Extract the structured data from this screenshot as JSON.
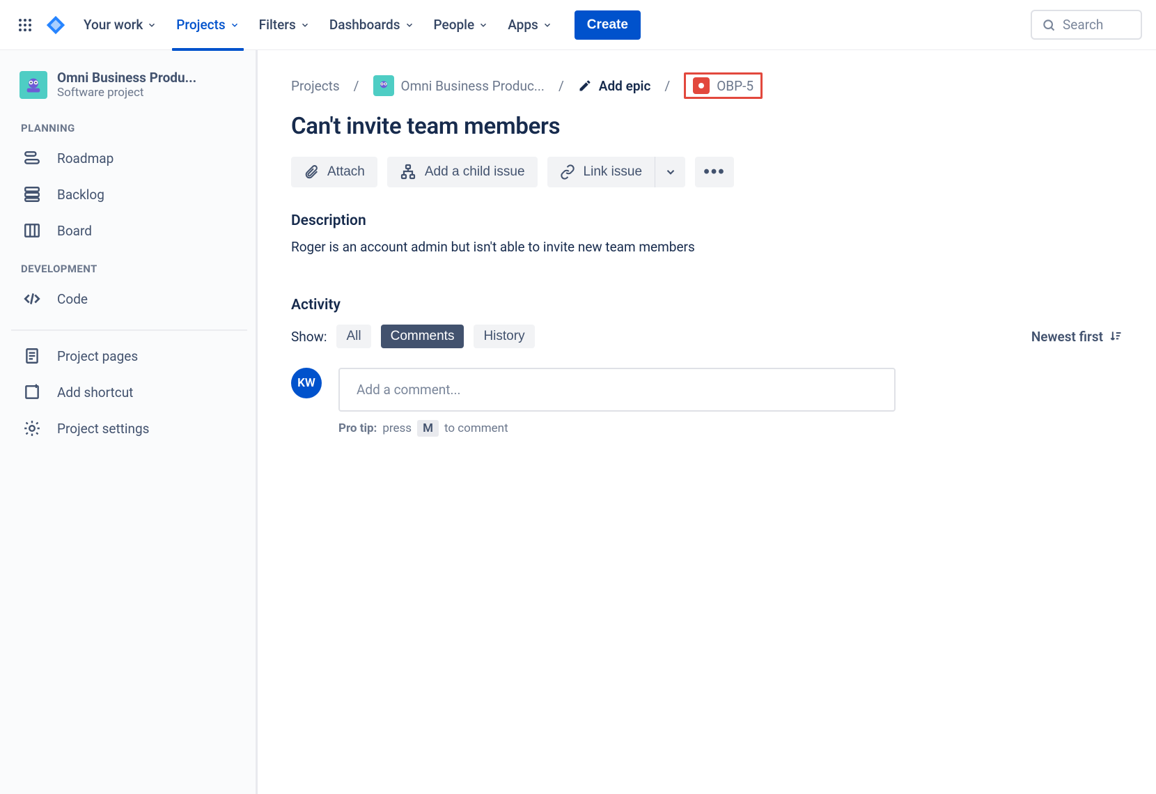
{
  "nav": {
    "items": [
      "Your work",
      "Projects",
      "Filters",
      "Dashboards",
      "People",
      "Apps"
    ],
    "create": "Create",
    "search_placeholder": "Search"
  },
  "sidebar": {
    "project_name": "Omni Business Produ...",
    "project_type": "Software project",
    "section_planning": "PLANNING",
    "section_development": "DEVELOPMENT",
    "planning_items": [
      "Roadmap",
      "Backlog",
      "Board"
    ],
    "dev_items": [
      "Code"
    ],
    "bottom_items": [
      "Project pages",
      "Add shortcut",
      "Project settings"
    ]
  },
  "breadcrumb": {
    "projects": "Projects",
    "project": "Omni Business Produc...",
    "add_epic": "Add epic",
    "issue_key": "OBP-5"
  },
  "issue": {
    "title": "Can't invite team members",
    "attach": "Attach",
    "add_child": "Add a child issue",
    "link_issue": "Link issue",
    "description_label": "Description",
    "description_text": "Roger is an account admin but isn't able to invite new team members"
  },
  "activity": {
    "label": "Activity",
    "show_label": "Show:",
    "tabs": [
      "All",
      "Comments",
      "History"
    ],
    "sort": "Newest first"
  },
  "comment": {
    "avatar_initials": "KW",
    "placeholder": "Add a comment...",
    "protip_label": "Pro tip:",
    "protip_pre": "press",
    "protip_key": "M",
    "protip_post": "to comment"
  }
}
